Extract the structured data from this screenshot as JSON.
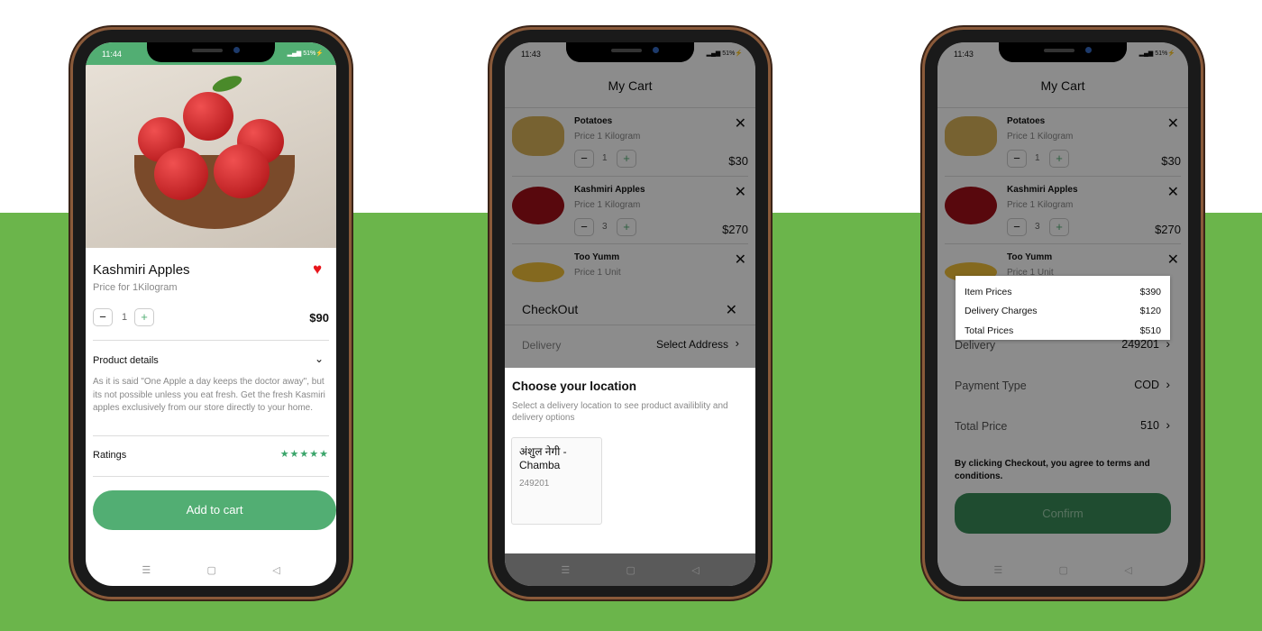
{
  "colors": {
    "brand_green": "#52ae73",
    "background_green": "#6bb54b",
    "heart": "#e8151b"
  },
  "product_screen": {
    "status_time": "11:44",
    "status_battery": "51%",
    "title": "Kashmiri Apples",
    "subtitle": "Price for 1Kilogram",
    "quantity": "1",
    "minus": "−",
    "plus": "+",
    "price": "$90",
    "details_label": "Product details",
    "description": "As it is said \"One Apple a day keeps the doctor away\", but its not possible unless you eat fresh. Get the fresh Kasmiri apples exclusively from our store directly to your home.",
    "ratings_label": "Ratings",
    "rating_stars": "★★★★★",
    "rating": 5,
    "add_to_cart": "Add to cart"
  },
  "cart": {
    "title": "My Cart",
    "items": [
      {
        "name": "Potatoes",
        "unit": "Price 1 Kilogram",
        "qty": "1",
        "price": "$30"
      },
      {
        "name": "Kashmiri Apples",
        "unit": "Price 1 Kilogram",
        "qty": "3",
        "price": "$270"
      },
      {
        "name": "Too Yumm",
        "unit": "Price 1 Unit",
        "qty": "",
        "price": ""
      }
    ]
  },
  "select_screen": {
    "status_time": "11:43",
    "status_battery": "51%",
    "checkout_title": "CheckOut",
    "delivery_label": "Delivery",
    "delivery_value": "Select Address",
    "sheet_title": "Choose your location",
    "sheet_subtitle": "Select a delivery location to see product availiblity and delivery options",
    "address_name": "अंशुल नेगी  - Chamba",
    "address_pin": "249201"
  },
  "confirm_screen": {
    "status_time": "11:43",
    "status_battery": "51%",
    "popup": [
      {
        "label": "Item Prices",
        "value": "$390"
      },
      {
        "label": "Delivery Charges",
        "value": "$120"
      },
      {
        "label": "Total Prices",
        "value": "$510"
      }
    ],
    "delivery_label": "Delivery",
    "delivery_value": "249201",
    "payment_label": "Payment Type",
    "payment_value": "COD",
    "total_label": "Total Price",
    "total_value": "510",
    "terms": "By clicking Checkout, you agree to terms and conditions.",
    "confirm": "Confirm"
  }
}
